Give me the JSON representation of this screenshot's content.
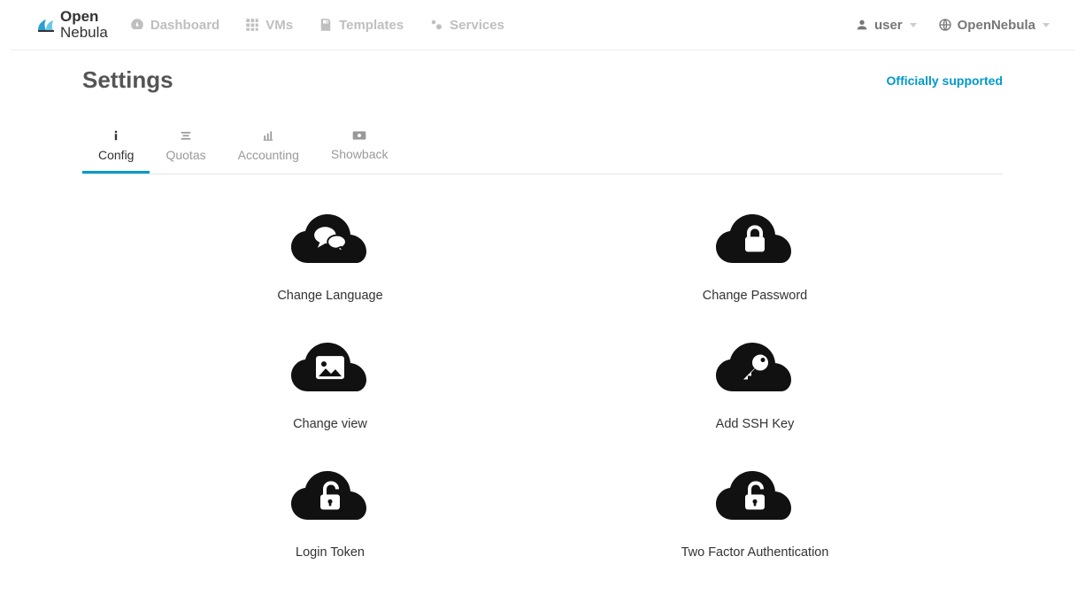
{
  "brand": {
    "part1": "Open",
    "part2": "Nebula"
  },
  "nav": {
    "dashboard": "Dashboard",
    "vms": "VMs",
    "templates": "Templates",
    "services": "Services"
  },
  "user": {
    "name": "user",
    "zone": "OpenNebula"
  },
  "page": {
    "title": "Settings",
    "support_link": "Officially supported"
  },
  "tabs": {
    "config": "Config",
    "quotas": "Quotas",
    "accounting": "Accounting",
    "showback": "Showback"
  },
  "tiles": {
    "change_language": "Change Language",
    "change_password": "Change Password",
    "change_view": "Change view",
    "add_ssh_key": "Add SSH Key",
    "login_token": "Login Token",
    "two_factor_auth": "Two Factor Authentication"
  }
}
